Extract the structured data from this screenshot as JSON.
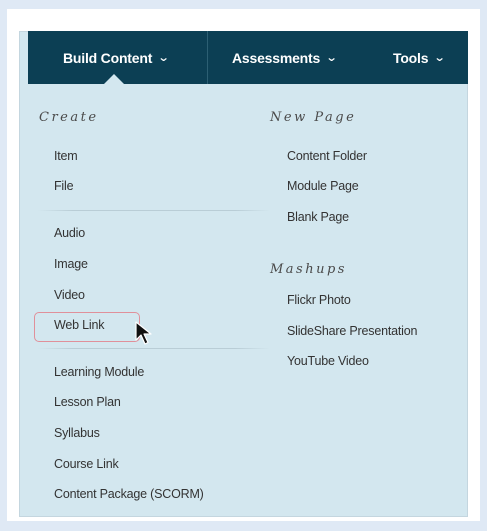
{
  "menubar": {
    "tabs": [
      {
        "label": "Build Content",
        "icon": "chevron-down-icon"
      },
      {
        "label": "Assessments",
        "icon": "chevron-down-icon"
      },
      {
        "label": "Tools",
        "icon": "chevron-down-icon"
      }
    ]
  },
  "dropdown": {
    "create": {
      "heading": "Create",
      "group1": [
        "Item",
        "File"
      ],
      "group2": [
        "Audio",
        "Image",
        "Video",
        "Web Link"
      ],
      "group3": [
        "Learning Module",
        "Lesson Plan",
        "Syllabus",
        "Course Link",
        "Content Package (SCORM)"
      ]
    },
    "new_page": {
      "heading": "New Page",
      "items": [
        "Content Folder",
        "Module Page",
        "Blank Page"
      ]
    },
    "mashups": {
      "heading": "Mashups",
      "items": [
        "Flickr Photo",
        "SlideShare Presentation",
        "YouTube Video"
      ]
    }
  },
  "highlighted_item": "Web Link",
  "colors": {
    "menubar": "#0c3f54",
    "dropdown_bg": "#d3e7ef",
    "highlight_border": "#e0909a"
  }
}
